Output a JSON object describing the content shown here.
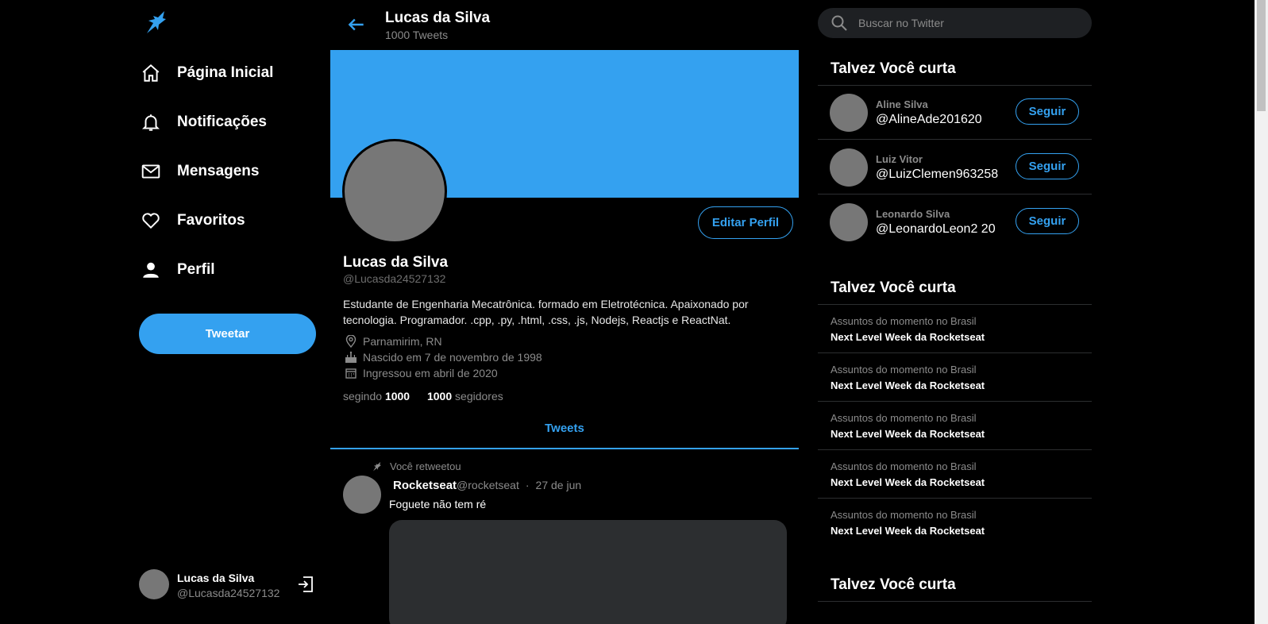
{
  "nav": {
    "logo_icon": "rocket-bird-logo",
    "items": [
      {
        "label": "Página Inicial",
        "icon": "home-icon"
      },
      {
        "label": "Notificações",
        "icon": "bell-icon"
      },
      {
        "label": "Mensagens",
        "icon": "envelope-icon"
      },
      {
        "label": "Favoritos",
        "icon": "heart-icon"
      },
      {
        "label": "Perfil",
        "icon": "person-icon"
      }
    ],
    "tweet_button": "Tweetar",
    "me": {
      "name": "Lucas da Silva",
      "handle": "@Lucasda24527132",
      "exit_icon": "logout-icon"
    }
  },
  "header": {
    "title": "Lucas da Silva",
    "count": "1000 Tweets"
  },
  "profile": {
    "edit_button": "Editar Perfil",
    "name": "Lucas da Silva",
    "handle": "@Lucasda24527132",
    "bio": "Estudante de Engenharia Mecatrônica. formado em Eletrotécnica. Apaixonado por tecnologia. Programador. .cpp, .py, .html, .css, .js, Nodejs, Reactjs e ReactNat.",
    "location": "Parnamirim, RN",
    "birth": "Nascido em 7 de novembro de 1998",
    "joined": "Ingressou em abril de 2020",
    "following_label": "segindo",
    "following_count": "1000",
    "followers_count": "1000",
    "followers_label": "segidores",
    "banner_color": "#34a1f0"
  },
  "tabs": {
    "tweets": "Tweets"
  },
  "tweet": {
    "retweet_label": "Você retweetou",
    "author": "Rocketseat",
    "handle": "@rocketseat",
    "separator": "·",
    "date": "27 de jun",
    "text": "Foguete não tem ré"
  },
  "search": {
    "placeholder": "Buscar no Twitter"
  },
  "suggestions": {
    "title": "Talvez Você curta",
    "follow_label": "Seguir",
    "people": [
      {
        "name": "Aline Silva",
        "handle": "@AlineAde201620"
      },
      {
        "name": "Luiz Vitor",
        "handle": "@LuizClemen963258"
      },
      {
        "name": "Leonardo Silva",
        "handle": "@LeonardoLeon2 20"
      }
    ]
  },
  "trends": {
    "title": "Talvez Você curta",
    "items": [
      {
        "context": "Assuntos do momento no Brasil",
        "topic": "Next Level Week da Rocketseat"
      },
      {
        "context": "Assuntos do momento no Brasil",
        "topic": "Next Level Week da Rocketseat"
      },
      {
        "context": "Assuntos do momento no Brasil",
        "topic": "Next Level Week da Rocketseat"
      },
      {
        "context": "Assuntos do momento no Brasil",
        "topic": "Next Level Week da Rocketseat"
      },
      {
        "context": "Assuntos do momento no Brasil",
        "topic": "Next Level Week da Rocketseat"
      }
    ]
  },
  "more": {
    "title": "Talvez Você curta"
  },
  "colors": {
    "accent": "#34a1f0",
    "background": "#000000",
    "muted": "#8b8b8b",
    "card": "#2c2e30"
  }
}
